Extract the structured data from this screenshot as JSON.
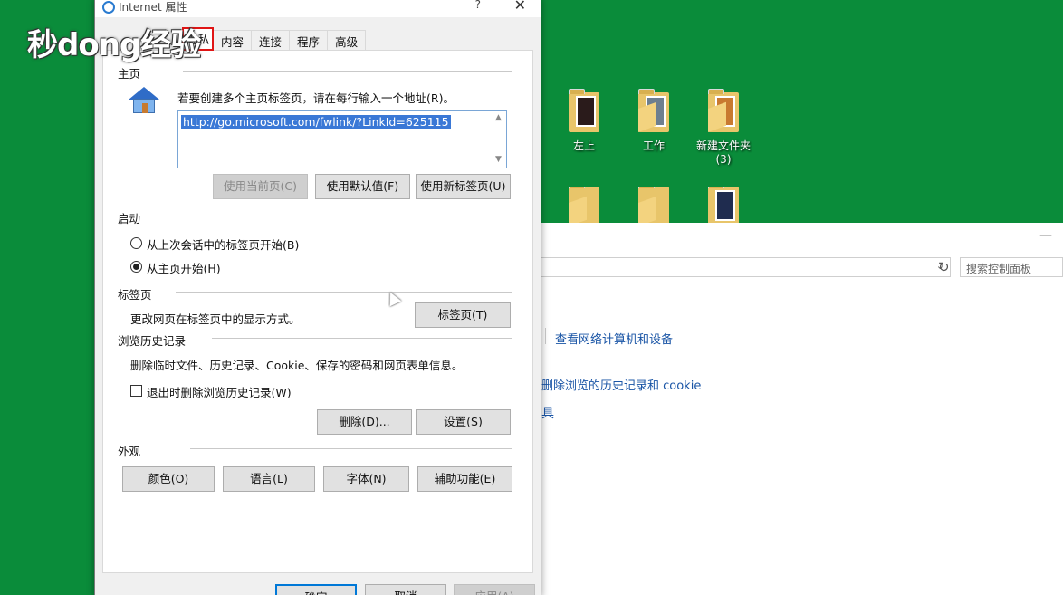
{
  "watermark": "秒dong经验",
  "desktop": {
    "icons": [
      {
        "label": "左上"
      },
      {
        "label": "工作"
      },
      {
        "label": "新建文件夹 (3)"
      }
    ]
  },
  "control_panel": {
    "search_placeholder": "搜索控制面板",
    "link_network": "查看网络计算机和设备",
    "link_history": "删除浏览的历史记录和 cookie",
    "fragment": "具"
  },
  "dialog": {
    "title": "Internet 属性",
    "help": "?",
    "close": "✕",
    "tabs": [
      {
        "label": "隐私",
        "active": true
      },
      {
        "label": "内容"
      },
      {
        "label": "连接"
      },
      {
        "label": "程序"
      },
      {
        "label": "高级"
      }
    ],
    "home": {
      "heading": "主页",
      "instruction": "若要创建多个主页标签页，请在每行输入一个地址(R)。",
      "url": "http://go.microsoft.com/fwlink/?LinkId=625115",
      "btn_current": "使用当前页(C)",
      "btn_default": "使用默认值(F)",
      "btn_newtab": "使用新标签页(U)"
    },
    "startup": {
      "heading": "启动",
      "option_last_session": "从上次会话中的标签页开始(B)",
      "option_home": "从主页开始(H)",
      "selected": "home"
    },
    "tabs_section": {
      "heading": "标签页",
      "description": "更改网页在标签页中的显示方式。",
      "button": "标签页(T)"
    },
    "history": {
      "heading": "浏览历史记录",
      "description": "删除临时文件、历史记录、Cookie、保存的密码和网页表单信息。",
      "checkbox_label": "退出时删除浏览历史记录(W)",
      "checkbox_checked": false,
      "btn_delete": "删除(D)...",
      "btn_settings": "设置(S)"
    },
    "appearance": {
      "heading": "外观",
      "btn_colors": "颜色(O)",
      "btn_language": "语言(L)",
      "btn_fonts": "字体(N)",
      "btn_accessibility": "辅助功能(E)"
    },
    "footer": {
      "ok": "确定",
      "cancel": "取消",
      "apply": "应用(A)"
    }
  }
}
